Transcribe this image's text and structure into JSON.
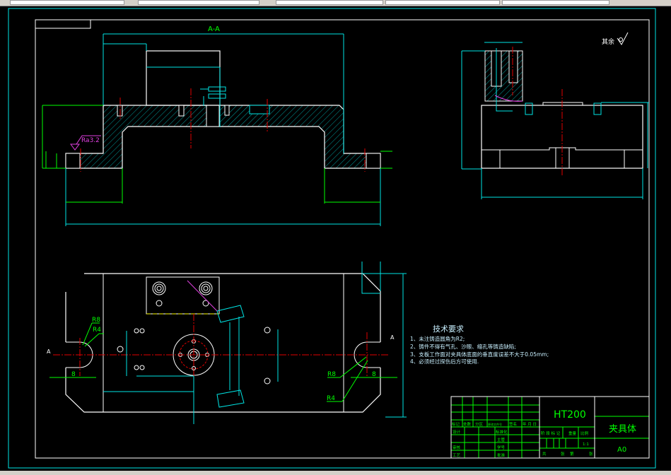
{
  "drawing": {
    "section_label": "A-A",
    "roughness_label": "Ra3.2",
    "remaining_roughness": "其余",
    "section_mark_left": "A",
    "section_mark_right": "A",
    "radius_large": "R8",
    "radius_small": "R4",
    "slot_width": "8"
  },
  "tech_requirements": {
    "title": "技术要求",
    "items": [
      "1、未注铸造圆角为R2;",
      "2、铸件不得有气孔、沙眼、缩孔等铸造缺陷;",
      "3、支板工作面对夹具体底面的垂直度误差不大于0.05mm;",
      "4、必须经过探伤后方可使用."
    ]
  },
  "title_block": {
    "material": "HT200",
    "part_name": "夹具体",
    "sheet_size": "A0",
    "scale": "1:1",
    "revision_headers": [
      "标记",
      "处数",
      "分区",
      "更改文件号",
      "签名",
      "年 月 日"
    ],
    "signoff_left": [
      "设计",
      "",
      "审核",
      "工艺"
    ],
    "signoff_right": [
      "标准化",
      "主管",
      "学号",
      "批准"
    ],
    "stage_headers": [
      "阶 段 标 记",
      "重量",
      "比例"
    ],
    "sheet_count": [
      "共",
      "张",
      "第",
      "张"
    ]
  },
  "colors": {
    "outline": "#ffffff",
    "dimension": "#00e5e5",
    "centerline": "#e00000",
    "annotation": "#00ff00",
    "roughness": "#e040e0",
    "text": "#c8f0ff"
  }
}
